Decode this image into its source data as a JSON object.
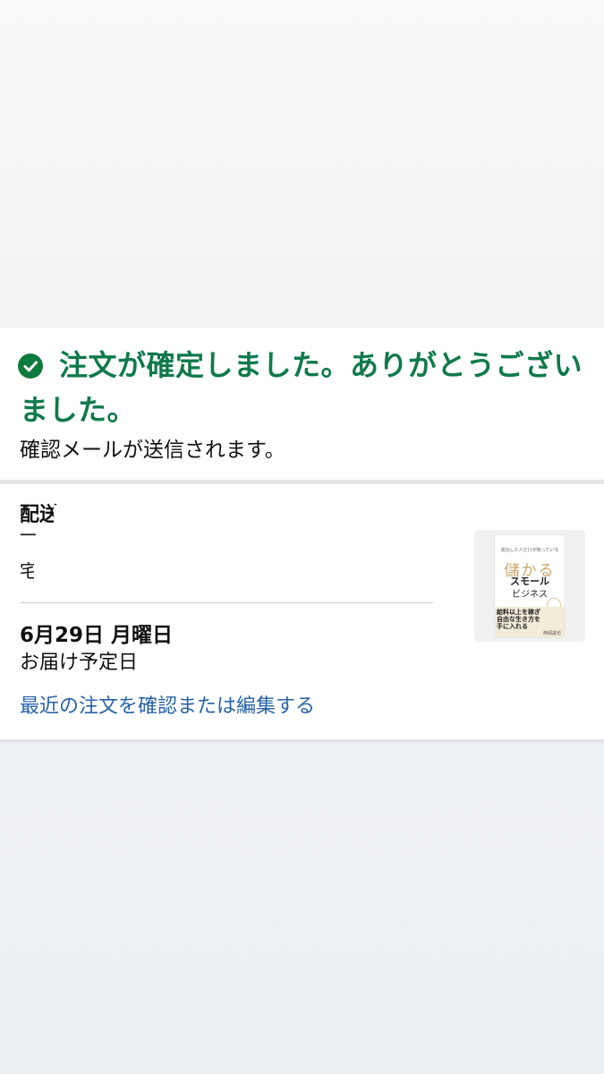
{
  "confirmation": {
    "title": "注文が確定しました。ありがとうございました。",
    "subtitle": "確認メールが送信されます。",
    "icon": "check-circle-icon",
    "accent_color": "#0f7a4a"
  },
  "delivery": {
    "heading_partial": "配送",
    "address_line_partial_1": "一",
    "address_line_partial_2": "宅",
    "date": "6月29日 月曜日",
    "date_label": "お届け予定日",
    "edit_link": "最近の注文を確認または編集する",
    "link_color": "#2763a8"
  },
  "product": {
    "kicker": "成功した人だけが知っている",
    "title_main": "儲かる",
    "title_line1": "スモール",
    "title_line2": "ビジネス",
    "band_text_1": "給料以上を稼ぎ",
    "band_text_2": "自由な生き方を",
    "band_text_3": "手に入れる",
    "author": "西岡誠也"
  }
}
